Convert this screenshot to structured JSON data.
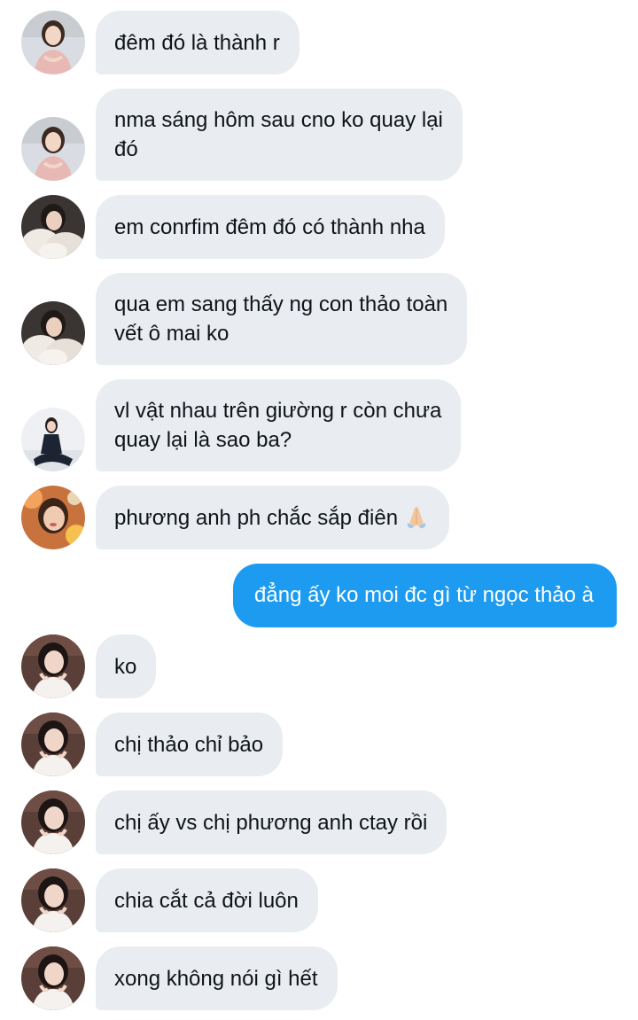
{
  "messages": [
    {
      "side": "in",
      "avatar": "avatar-pink-dress",
      "text": "đêm đó là thành r"
    },
    {
      "side": "in",
      "avatar": "avatar-pink-dress",
      "text": "nma sáng hôm sau cno ko quay lại\nđó"
    },
    {
      "side": "in",
      "avatar": "avatar-white-fur",
      "text": "em conrfim đêm đó có thành nha"
    },
    {
      "side": "in",
      "avatar": "avatar-white-fur",
      "text": "qua em sang thấy ng con thảo toàn\nvết ô mai ko"
    },
    {
      "side": "in",
      "avatar": "avatar-navy-dress",
      "text": "vl vật nhau trên giường r còn chưa\nquay lại là sao ba?"
    },
    {
      "side": "in",
      "avatar": "avatar-flowers",
      "text": "phương anh ph chắc sắp điên",
      "emoji": "folded-hands-emoji"
    },
    {
      "side": "out",
      "text": "đẳng ấy ko moi đc gì từ ngọc thảo à"
    },
    {
      "side": "in",
      "avatar": "avatar-dark-hair",
      "text": "ko"
    },
    {
      "side": "in",
      "avatar": "avatar-dark-hair",
      "text": "chị thảo chỉ bảo"
    },
    {
      "side": "in",
      "avatar": "avatar-dark-hair",
      "text": "chị ấy vs chị phương anh ctay rồi"
    },
    {
      "side": "in",
      "avatar": "avatar-dark-hair",
      "text": "chia cắt cả đời luôn"
    },
    {
      "side": "in",
      "avatar": "avatar-dark-hair",
      "text": "xong không nói gì hết"
    }
  ],
  "colors": {
    "incoming_bubble": "#e9ecf0",
    "outgoing_bubble": "#1d9bf0",
    "incoming_text": "#0f1419",
    "outgoing_text": "#ffffff"
  }
}
